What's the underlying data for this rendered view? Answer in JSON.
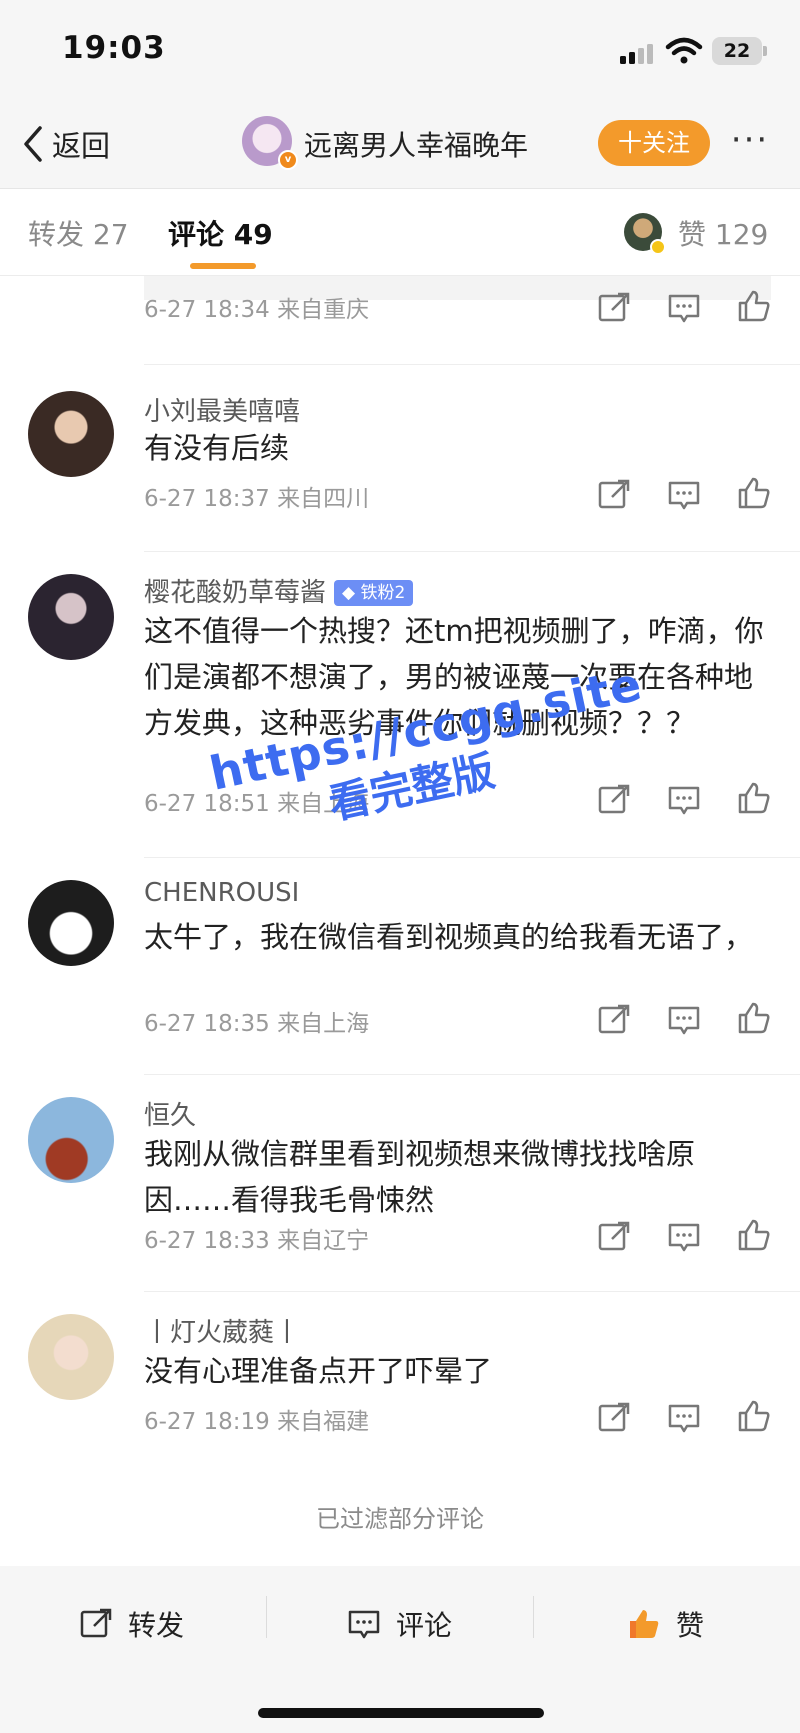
{
  "status": {
    "time": "19:03",
    "battery": "22"
  },
  "nav": {
    "back_label": "返回",
    "title": "远离男人幸福晚年",
    "follow_label": "十关注",
    "more_label": "···"
  },
  "tabs": {
    "forward": "转发 27",
    "comment": "评论 49",
    "likes": "赞 129"
  },
  "comments": [
    {
      "meta": "6-27 18:34 来自重庆"
    },
    {
      "user": "小刘最美嘻嘻",
      "text": "有没有后续",
      "meta": "6-27 18:37 来自四川"
    },
    {
      "user": "樱花酸奶草莓酱",
      "badge": "铁粉2",
      "text": "这不值得一个热搜？还tm把视频删了，咋滴，你们是演都不想演了，男的被诬蔑一次要在各种地方发典，这种恶劣事件你们就删视频？？？",
      "meta": "6-27 18:51 来自上海"
    },
    {
      "user": "CHENROUSI",
      "text": "太牛了，我在微信看到视频真的给我看无语了，",
      "meta": "6-27 18:35 来自上海"
    },
    {
      "user": "恒久",
      "text": "我刚从微信群里看到视频想来微博找找啥原因……看得我毛骨悚然",
      "meta": "6-27 18:33 来自辽宁"
    },
    {
      "user": "丨灯火葳蕤丨",
      "text": "没有心理准备点开了吓晕了",
      "meta": "6-27 18:19 来自福建"
    }
  ],
  "filtered_text": "已过滤部分评论",
  "bottom": {
    "forward": "转发",
    "comment": "评论",
    "like": "赞"
  },
  "watermark": {
    "line1": "https://ccgg.site",
    "line2": "看完整版"
  },
  "colors": {
    "accent": "#f39a2b",
    "watermark": "#3d6cf0",
    "fan_badge": "#6c8ef5"
  }
}
